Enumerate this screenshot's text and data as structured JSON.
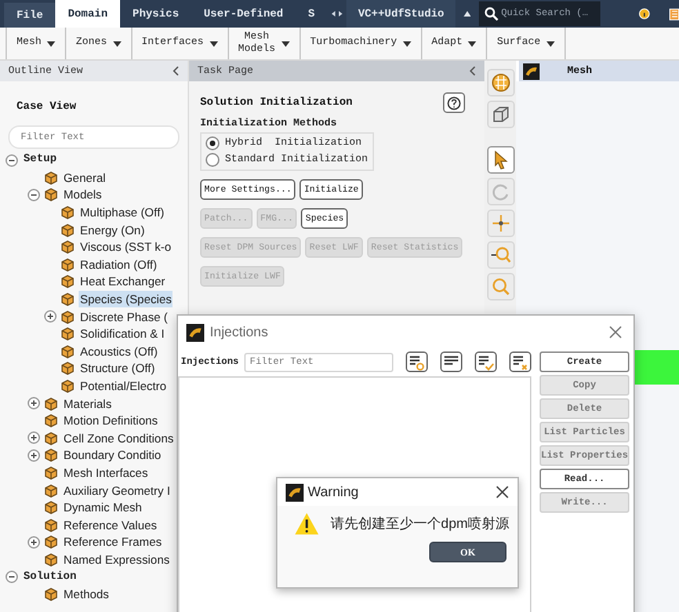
{
  "ribbon_tabs": [
    {
      "label": "File",
      "selected": false
    },
    {
      "label": "Domain",
      "selected": true
    },
    {
      "label": "Physics",
      "selected": false
    },
    {
      "label": "User-Defined",
      "selected": false
    },
    {
      "label": "S",
      "selected": false
    }
  ],
  "addon_tab": {
    "label": "VC++UdfStudio"
  },
  "search": {
    "placeholder": "Quick Search (…"
  },
  "ribbon_groups": [
    {
      "label": "Mesh"
    },
    {
      "label": "Zones"
    },
    {
      "label": "Interfaces"
    },
    {
      "label": "Mesh\nModels"
    },
    {
      "label": "Turbomachinery"
    },
    {
      "label": "Adapt"
    },
    {
      "label": "Surface"
    }
  ],
  "outline": {
    "title": "Outline View",
    "case_view": "Case View",
    "filter": {
      "placeholder": "Filter Text"
    },
    "tree": [
      {
        "label": "Setup",
        "section": true,
        "expanded": true,
        "selected": false,
        "children": [
          {
            "label": "General",
            "selected": false
          },
          {
            "label": "Models",
            "expanded": true,
            "selected": false,
            "children": [
              {
                "label": "Multiphase (Off)",
                "selected": false
              },
              {
                "label": "Energy (On)",
                "selected": false
              },
              {
                "label": "Viscous (SST k-o",
                "selected": false
              },
              {
                "label": "Radiation (Off)",
                "selected": false
              },
              {
                "label": "Heat Exchanger",
                "selected": false
              },
              {
                "label": "Species (Species",
                "selected": true
              },
              {
                "label": "Discrete Phase (",
                "expanded": false,
                "selected": false
              },
              {
                "label": "Solidification & I",
                "selected": false
              },
              {
                "label": "Acoustics (Off)",
                "selected": false
              },
              {
                "label": "Structure (Off)",
                "selected": false
              },
              {
                "label": "Potential/Electro",
                "selected": false
              }
            ]
          },
          {
            "label": "Materials",
            "expanded": false,
            "selected": false
          },
          {
            "label": "Motion Definitions",
            "selected": false
          },
          {
            "label": "Cell Zone Conditions",
            "expanded": false,
            "selected": false
          },
          {
            "label": "Boundary Conditio",
            "expanded": false,
            "selected": false
          },
          {
            "label": "Mesh Interfaces",
            "selected": false
          },
          {
            "label": "Auxiliary Geometry I",
            "selected": false
          },
          {
            "label": "Dynamic Mesh",
            "selected": false
          },
          {
            "label": "Reference Values",
            "selected": false
          },
          {
            "label": "Reference Frames",
            "expanded": false,
            "selected": false
          },
          {
            "label": "Named Expressions",
            "selected": false
          }
        ]
      },
      {
        "label": "Solution",
        "section": true,
        "expanded": true,
        "selected": false,
        "children": [
          {
            "label": "Methods",
            "selected": false
          }
        ]
      }
    ]
  },
  "task_page": {
    "title": "Task Page",
    "heading": "Solution Initialization",
    "methods_label": "Initialization Methods",
    "methods": [
      {
        "label": "Hybrid  Initialization",
        "selected": true
      },
      {
        "label": "Standard Initialization",
        "selected": false
      }
    ],
    "button_rows": [
      [
        {
          "label": "More Settings...",
          "disabled": false
        },
        {
          "label": "Initialize",
          "disabled": false
        }
      ],
      [
        {
          "label": "Patch...",
          "disabled": true
        },
        {
          "label": "FMG...",
          "disabled": true
        },
        {
          "label": "Species",
          "disabled": false
        }
      ],
      [
        {
          "label": "Reset DPM Sources",
          "disabled": true
        },
        {
          "label": "Reset LWF",
          "disabled": true
        },
        {
          "label": "Reset Statistics",
          "disabled": true
        }
      ],
      [
        {
          "label": "Initialize LWF",
          "disabled": true
        }
      ]
    ]
  },
  "toolbar": [
    {
      "kind": "mesh",
      "selected": false
    },
    {
      "kind": "cube",
      "selected": false
    },
    {
      "kind": "pointer",
      "selected": true
    },
    {
      "kind": "rotate",
      "selected": false
    },
    {
      "kind": "pan",
      "selected": false
    },
    {
      "kind": "zoomout",
      "selected": false
    },
    {
      "kind": "zoom",
      "selected": false
    }
  ],
  "graphics": {
    "tab": "Mesh"
  },
  "injections_dialog": {
    "title": "Injections",
    "filter_label": "Injections",
    "filter": {
      "placeholder": "Filter Text"
    },
    "buttons": [
      {
        "label": "Create",
        "disabled": false
      },
      {
        "label": "Copy",
        "disabled": true
      },
      {
        "label": "Delete",
        "disabled": true
      },
      {
        "label": "List Particles",
        "disabled": true
      },
      {
        "label": "List Properties",
        "disabled": true
      },
      {
        "label": "Read...",
        "disabled": false
      },
      {
        "label": "Write...",
        "disabled": true
      }
    ]
  },
  "warning_dialog": {
    "title": "Warning",
    "message": "请先创建至少一个dpm喷射源",
    "ok": "OK"
  }
}
